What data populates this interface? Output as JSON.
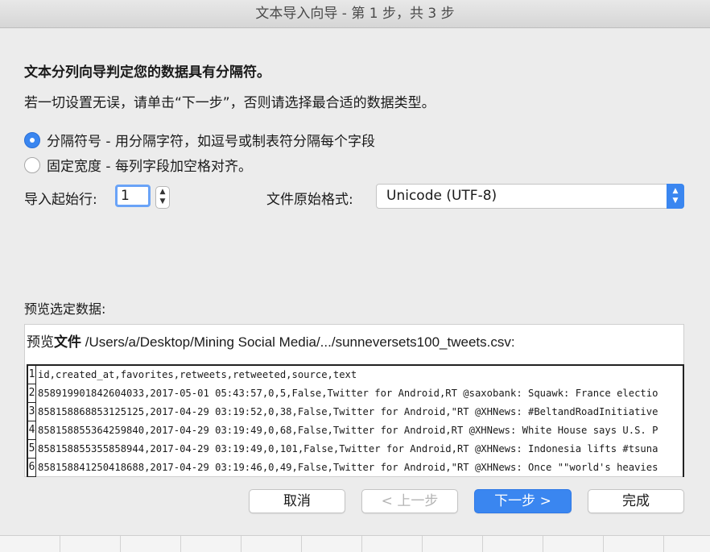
{
  "window": {
    "title": "文本导入向导 - 第 1 步，共 3 步"
  },
  "intro": {
    "heading": "文本分列向导判定您的数据具有分隔符。",
    "subheading": "若一切设置无误，请单击“下一步”，否则请选择最合适的数据类型。"
  },
  "options": {
    "delimited": {
      "label": "分隔符号 - 用分隔字符，如逗号或制表符分隔每个字段",
      "selected": true
    },
    "fixed_width": {
      "label": "固定宽度 - 每列字段加空格对齐。",
      "selected": false
    }
  },
  "start_row": {
    "label": "导入起始行:",
    "value": "1"
  },
  "file_origin": {
    "label": "文件原始格式:",
    "value": "Unicode (UTF-8)"
  },
  "preview": {
    "label": "预览选定数据:",
    "file_prefix": "预览",
    "file_word": "文件",
    "file_path": " /Users/a/Desktop/Mining Social Media/.../sunneversets100_tweets.csv:",
    "rows": [
      {
        "num": "1",
        "text": "id,created_at,favorites,retweets,retweeted,source,text"
      },
      {
        "num": "2",
        "text": "858919901842604033,2017-05-01 05:43:57,0,5,False,Twitter for Android,RT @saxobank: Squawk: France electio"
      },
      {
        "num": "3",
        "text": "858158868853125125,2017-04-29 03:19:52,0,38,False,Twitter for Android,\"RT @XHNews: #BeltandRoadInitiative"
      },
      {
        "num": "4",
        "text": "858158855364259840,2017-04-29 03:19:49,0,68,False,Twitter for Android,RT @XHNews: White House says U.S. P"
      },
      {
        "num": "5",
        "text": "858158855355858944,2017-04-29 03:19:49,0,101,False,Twitter for Android,RT @XHNews: Indonesia lifts #tsuna"
      },
      {
        "num": "6",
        "text": "858158841250418688,2017-04-29 03:19:46,0,49,False,Twitter for Android,\"RT @XHNews: Once \"\"world's heavies"
      }
    ]
  },
  "buttons": {
    "cancel": "取消",
    "back": "< 上一步",
    "next": "下一步 >",
    "finish": "完成"
  },
  "colors": {
    "accent": "#3a86f0",
    "focus_ring": "#6aa3f7",
    "dialog_bg": "#ececec"
  },
  "icons": {
    "stepper": "up-down-chevron-icon",
    "select": "up-down-chevron-icon"
  }
}
